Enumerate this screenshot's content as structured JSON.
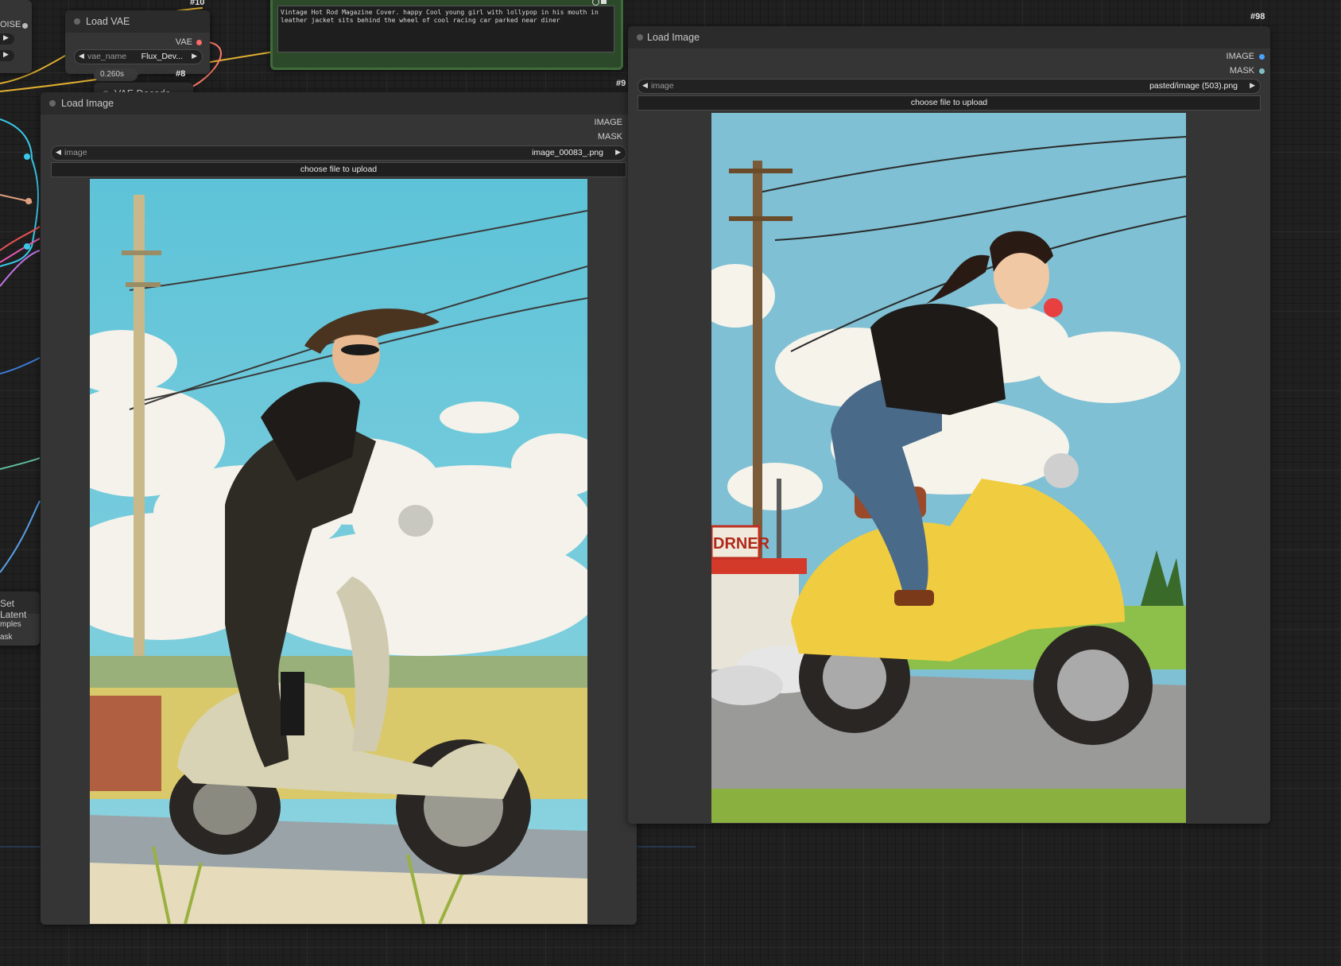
{
  "canvas": {
    "vae_node": {
      "title": "Load VAE",
      "id": "#10",
      "output_label": "VAE",
      "widget_name": "vae_name",
      "widget_value": "Flux_Dev...",
      "timing": "0.260s"
    },
    "left_partial_node": {
      "noise_label": "OISE"
    },
    "vae_decode_node": {
      "id": "#8",
      "title": "VAE Decode"
    },
    "prompt_node": {
      "text": "Vintage Hot Rod Magazine Cover. happy Cool young girl with lollypop in his mouth in leather jacket sits behind the wheel of cool racing car parked near diner",
      "id": "#9"
    },
    "set_latent_node": {
      "title": "Set Latent",
      "input1": "mples",
      "input2": "ask"
    },
    "load_image_left": {
      "title": "Load Image",
      "output_image": "IMAGE",
      "output_mask": "MASK",
      "widget_name": "image",
      "widget_value": "image_00083_.png",
      "upload_label": "choose file to upload",
      "picture_alt": "Vintage illustration of a woman in a wide-brim hat and sunglasses riding a cream scooter along a country road under power lines"
    },
    "load_image_right": {
      "title": "Load Image",
      "id": "#98",
      "output_image": "IMAGE",
      "output_mask": "MASK",
      "widget_name": "image",
      "widget_value": "pasted/image (503).png",
      "upload_label": "choose file to upload",
      "picture_alt": "Vintage illustration of a ponytailed girl in a leather jacket with a lollipop riding a yellow scooter past a diner",
      "diner_sign": "DRNER"
    },
    "colors": {
      "background": "#202020",
      "node_bg": "#353535",
      "node_title": "#2b2b2b",
      "prompt_border": "#3f6b3a",
      "image_slot": "#4aa3ff",
      "mask_slot": "#7fbfbf",
      "vae_slot": "#ff6b6b"
    }
  }
}
